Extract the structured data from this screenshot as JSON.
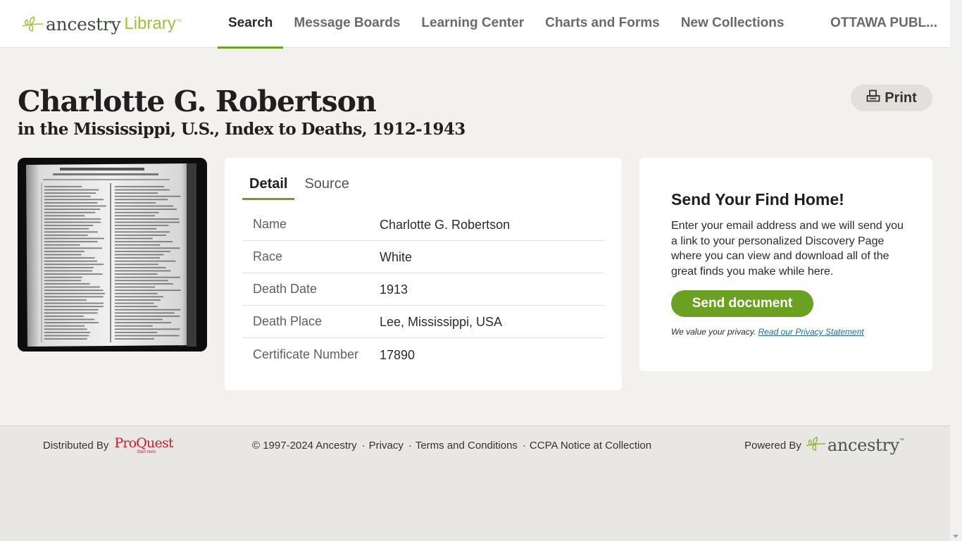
{
  "header": {
    "logo": {
      "brand": "ancestry",
      "product": "Library",
      "tm": "™",
      "icon": "leaf-icon"
    },
    "nav": [
      {
        "label": "Search",
        "active": true
      },
      {
        "label": "Message Boards",
        "active": false
      },
      {
        "label": "Learning Center",
        "active": false
      },
      {
        "label": "Charts and Forms",
        "active": false
      },
      {
        "label": "New Collections",
        "active": false
      }
    ],
    "account_label": "OTTAWA PUBL..."
  },
  "record": {
    "name": "Charlotte G. Robertson",
    "collection": "in the Mississippi, U.S., Index to Deaths, 1912-1943",
    "print_label": "Print"
  },
  "detail": {
    "tabs": [
      {
        "label": "Detail",
        "active": true
      },
      {
        "label": "Source",
        "active": false
      }
    ],
    "rows": [
      {
        "label": "Name",
        "value": "Charlotte G. Robertson"
      },
      {
        "label": "Race",
        "value": "White"
      },
      {
        "label": "Death Date",
        "value": "1913"
      },
      {
        "label": "Death Place",
        "value": "Lee, Mississippi, USA"
      },
      {
        "label": "Certificate Number",
        "value": "17890"
      }
    ]
  },
  "send": {
    "title": "Send Your Find Home!",
    "text": "Enter your email address and we will send you a link to your personalized Discovery Page where you can view and download all of the great finds you make while here.",
    "button": "Send document",
    "privacy_text": "We value your privacy.",
    "privacy_link": "Read our Privacy Statement"
  },
  "footer": {
    "distributed_by": "Distributed By",
    "proquest": "ProQuest",
    "proquest_tagline": "Start here.",
    "copyright": "© 1997-2024 Ancestry",
    "links": [
      "Privacy",
      "Terms and Conditions",
      "CCPA Notice at Collection"
    ],
    "powered_by": "Powered By",
    "powered_brand": "ancestry",
    "powered_tm": "™"
  },
  "colors": {
    "accent": "#6aa121",
    "background": "#f3f1ee",
    "footer": "#e9e7e3",
    "link": "#1f6c8e",
    "proquest": "#c7202f"
  }
}
